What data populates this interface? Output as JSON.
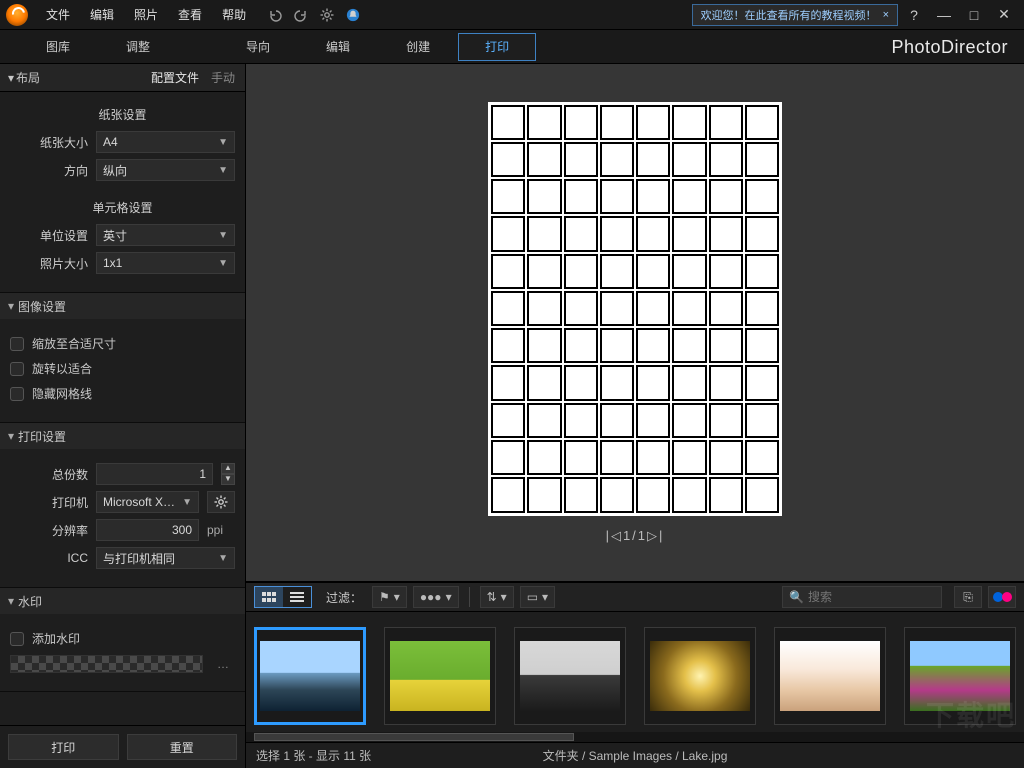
{
  "menu": {
    "file": "文件",
    "edit": "编辑",
    "photo": "照片",
    "view": "查看",
    "help": "帮助"
  },
  "welcome": {
    "text": "欢迎您！在此查看所有的教程视频！"
  },
  "brand": "PhotoDirector",
  "tabs": {
    "library": "图库",
    "adjust": "调整",
    "guided": "导向",
    "edit": "编辑",
    "create": "创建",
    "print": "打印"
  },
  "side_header": {
    "title": "布局",
    "tab_profile": "配置文件",
    "tab_manual": "手动"
  },
  "paper": {
    "subtitle": "纸张设置",
    "size_label": "纸张大小",
    "size_value": "A4",
    "orient_label": "方向",
    "orient_value": "纵向"
  },
  "cell": {
    "subtitle": "单元格设置",
    "unit_label": "单位设置",
    "unit_value": "英寸",
    "photo_label": "照片大小",
    "photo_value": "1x1"
  },
  "image_settings": {
    "title": "图像设置",
    "fit": "缩放至合适尺寸",
    "rotate": "旋转以适合",
    "hidegrid": "隐藏网格线"
  },
  "print_settings": {
    "title": "打印设置",
    "copies_label": "总份数",
    "copies_value": "1",
    "printer_label": "打印机",
    "printer_value": "Microsoft XPS D",
    "dpi_label": "分辨率",
    "dpi_value": "300",
    "dpi_unit": "ppi",
    "icc_label": "ICC",
    "icc_value": "与打印机相同"
  },
  "watermark": {
    "title": "水印",
    "add": "添加水印"
  },
  "footer": {
    "print": "打印",
    "reset": "重置"
  },
  "pager": "|◁1/1▷|",
  "strip": {
    "filter": "过滤：",
    "search_placeholder": "搜索"
  },
  "status": {
    "left": "选择 1 张 - 显示 11 张",
    "right": "文件夹 / Sample Images / Lake.jpg"
  },
  "grid": {
    "cols": 8,
    "rows": 11
  },
  "thumbs": [
    {
      "g": "linear-gradient(180deg,#a9d5ff 0%,#a9d5ff 45%,#6b9abf 46%,#2d4657 70%,#0e2233 100%)",
      "sel": true
    },
    {
      "g": "linear-gradient(180deg,#7bbf3a 0%,#6aad2e 55%,#e6d23a 56%,#c9b420 100%)"
    },
    {
      "g": "linear-gradient(180deg,#d8d8d8 0%,#cfcfcf 48%,#3a3a3a 49%,#1b1b1b 100%)"
    },
    {
      "g": "radial-gradient(circle at 50% 50%,#fff3b0 0%,#e4c04a 25%,#8a6a1d 60%,#3a2c0a 100%)"
    },
    {
      "g": "linear-gradient(180deg,#fff 0%,#f9e9db 40%,#e8c8a6 70%,#caa27c 100%)"
    },
    {
      "g": "linear-gradient(180deg,#8fc9ff 0%,#8fc9ff 35%,#6aa52b 36%,#b53a8a 70%,#3a6f1f 100%)"
    }
  ]
}
